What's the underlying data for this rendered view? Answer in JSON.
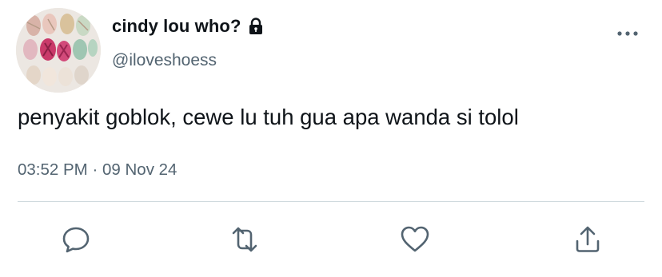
{
  "tweet": {
    "display_name": "cindy lou who?",
    "handle": "@iloveshoess",
    "text": "penyakit goblok, cewe lu tuh gua apa wanda si tolol",
    "time": "03:52 PM",
    "separator": "·",
    "date": "09 Nov 24",
    "protected": true
  },
  "icons": {
    "lock": "lock-icon",
    "more": "more-horizontal-icon",
    "reply": "reply-bubble-icon",
    "retweet": "retweet-icon",
    "like": "heart-icon",
    "share": "share-icon"
  },
  "colors": {
    "primary_text": "#0f1419",
    "secondary_text": "#536471",
    "divider": "#cfd9de",
    "icon": "#536471"
  }
}
